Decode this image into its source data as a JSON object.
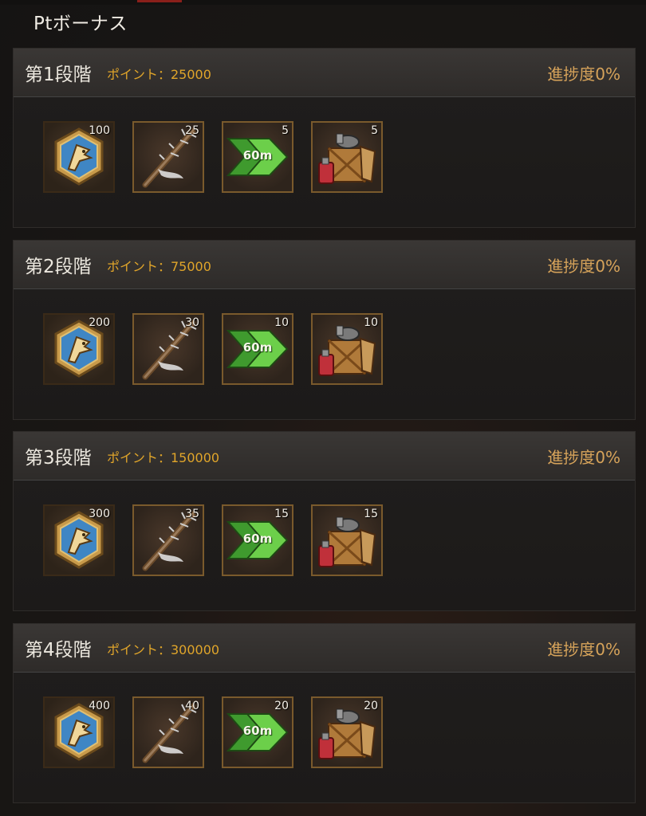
{
  "panel": {
    "title": "Ptボーナス"
  },
  "stages": [
    {
      "name": "第1段階",
      "points": "ポイント：25000",
      "progress": "進捗度0%",
      "rewards": [
        {
          "icon": "medal-icon",
          "count": "100"
        },
        {
          "icon": "spiked-club-icon",
          "count": "25"
        },
        {
          "icon": "speedup-icon",
          "count": "5",
          "label": "60m"
        },
        {
          "icon": "supply-crate-icon",
          "count": "5"
        }
      ]
    },
    {
      "name": "第2段階",
      "points": "ポイント：75000",
      "progress": "進捗度0%",
      "rewards": [
        {
          "icon": "medal-icon",
          "count": "200"
        },
        {
          "icon": "spiked-club-icon",
          "count": "30"
        },
        {
          "icon": "speedup-icon",
          "count": "10",
          "label": "60m"
        },
        {
          "icon": "supply-crate-icon",
          "count": "10"
        }
      ]
    },
    {
      "name": "第3段階",
      "points": "ポイント：150000",
      "progress": "進捗度0%",
      "rewards": [
        {
          "icon": "medal-icon",
          "count": "300"
        },
        {
          "icon": "spiked-club-icon",
          "count": "35"
        },
        {
          "icon": "speedup-icon",
          "count": "15",
          "label": "60m"
        },
        {
          "icon": "supply-crate-icon",
          "count": "15"
        }
      ]
    },
    {
      "name": "第4段階",
      "points": "ポイント：300000",
      "progress": "進捗度0%",
      "rewards": [
        {
          "icon": "medal-icon",
          "count": "400"
        },
        {
          "icon": "spiked-club-icon",
          "count": "40"
        },
        {
          "icon": "speedup-icon",
          "count": "20",
          "label": "60m"
        },
        {
          "icon": "supply-crate-icon",
          "count": "20"
        }
      ]
    }
  ],
  "colors": {
    "points": "#e0a52a",
    "progress": "#d6a35a",
    "frame": "#7a5a2c"
  }
}
